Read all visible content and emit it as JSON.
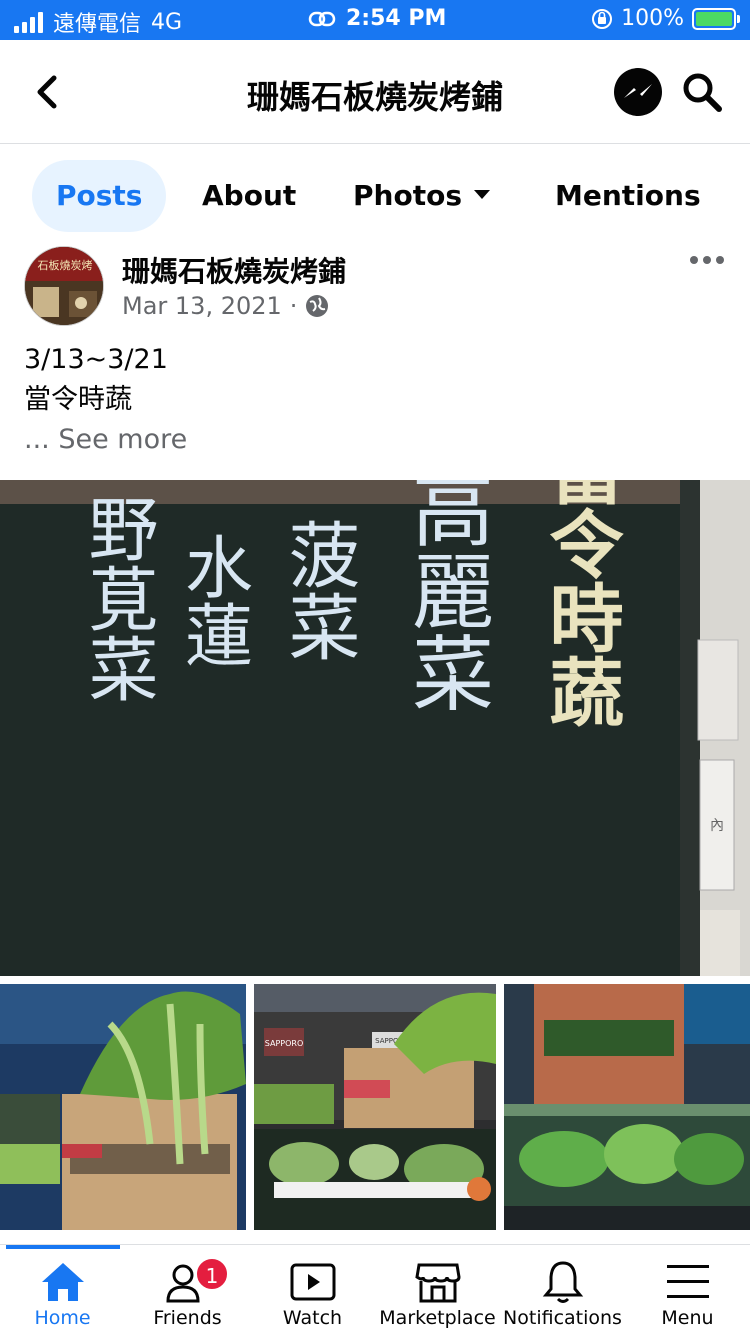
{
  "status_bar": {
    "carrier": "遠傳電信",
    "network": "4G",
    "time": "2:54 PM",
    "battery": "100%",
    "icons": [
      "signal-icon",
      "link-icon",
      "orientation-lock-icon",
      "battery-charging-icon"
    ]
  },
  "header": {
    "title": "珊媽石板燒炭烤鋪",
    "icons": [
      "back-icon",
      "messenger-icon",
      "search-icon"
    ]
  },
  "tabs": [
    {
      "label": "Posts",
      "active": true
    },
    {
      "label": "About",
      "active": false
    },
    {
      "label": "Photos",
      "active": false
    },
    {
      "label": "Mentions",
      "active": false
    }
  ],
  "post": {
    "author": "珊媽石板燒炭烤鋪",
    "date": "Mar 13, 2021",
    "separator": "·",
    "text_line1": "3/13~3/21",
    "text_line2": "當令時蔬",
    "see_more": "... See more",
    "avatar_sign_text": "石板燒炭烤",
    "chalkboard": {
      "col1": "當令時蔬",
      "col2": "高麗菜",
      "col3": "菠菜",
      "col4": "水蓮",
      "col5": "野莧菜",
      "side_sign": "內"
    },
    "thumbnail_labels": [
      "SAPPORO",
      "SAPPORO"
    ]
  },
  "bottom_nav": {
    "items": [
      {
        "label": "Home",
        "icon": "home-icon",
        "active": true
      },
      {
        "label": "Friends",
        "icon": "friends-icon",
        "badge": "1"
      },
      {
        "label": "Watch",
        "icon": "watch-icon"
      },
      {
        "label": "Marketplace",
        "icon": "marketplace-icon"
      },
      {
        "label": "Notifications",
        "icon": "bell-icon"
      },
      {
        "label": "Menu",
        "icon": "menu-icon"
      }
    ]
  },
  "colors": {
    "brand_blue": "#1877f2",
    "tab_active_bg": "#e7f3ff",
    "secondary_text": "#65676b",
    "badge_red": "#e41e3f",
    "chalkboard": "#1f2a27"
  }
}
